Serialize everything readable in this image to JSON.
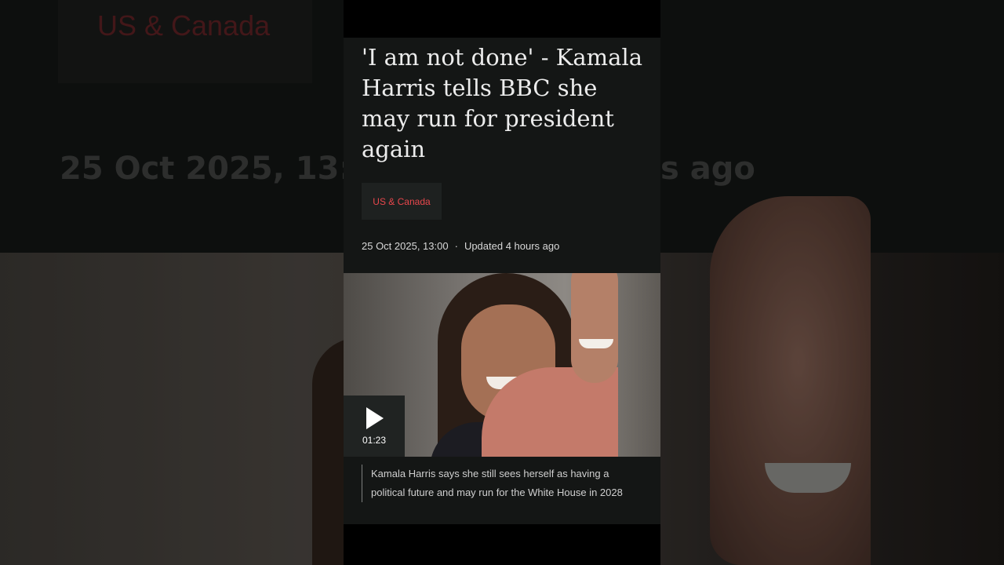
{
  "background": {
    "tag_label": "US & Canada",
    "date_text": "25 Oct 2025, 13:00",
    "updated_suffix": "s ago"
  },
  "article": {
    "headline": "'I am not done' - Kamala Harris tells BBC she may run for president again",
    "tag_label": "US & Canada",
    "published": "25 Oct 2025, 13:00",
    "separator": "·",
    "updated": "Updated 4 hours ago",
    "video": {
      "duration": "01:23",
      "play_icon": "play-icon"
    },
    "caption": "Kamala Harris says she still sees herself as having a political future and may run for the White House in 2028"
  },
  "colors": {
    "accent": "#e8474c",
    "card_background": "#141615"
  }
}
